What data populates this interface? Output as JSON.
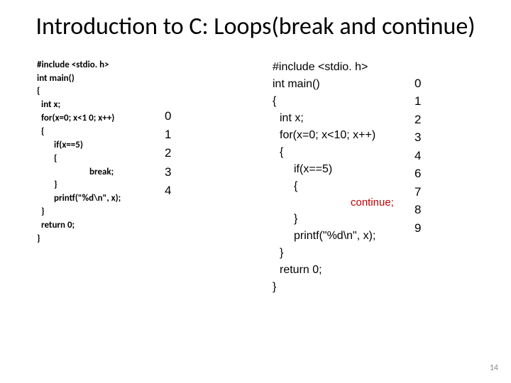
{
  "title": "Introduction to C: Loops(break and continue)",
  "left_code": {
    "l0": "#include <stdio. h>",
    "l1": "int main()",
    "l2": "{",
    "l3": "int x;",
    "l4": "for(x=0; x<1 0; x++)",
    "l5": "{",
    "l6": "if(x==5)",
    "l7": "{",
    "l8": "break;",
    "l9": "}",
    "l10": "printf(\"%d\\n\", x);",
    "l11": "}",
    "l12": "return 0;",
    "l13": "}"
  },
  "left_output": [
    "0",
    "1",
    "2",
    "3",
    "4"
  ],
  "right_code": {
    "l0": "#include <stdio. h>",
    "l1": "int main()",
    "l2": "{",
    "l3": "int x;",
    "l4": "for(x=0; x<10; x++)",
    "l5": "{",
    "l6": "if(x==5)",
    "l7": "{",
    "l8": "continue;",
    "l9": "}",
    "l10": "printf(\"%d\\n\", x);",
    "l11": "}",
    "l12": "return 0;",
    "l13": "}"
  },
  "right_output": [
    "0",
    "1",
    "2",
    "3",
    "4",
    "6",
    "7",
    "8",
    "9"
  ],
  "page_num": "14"
}
